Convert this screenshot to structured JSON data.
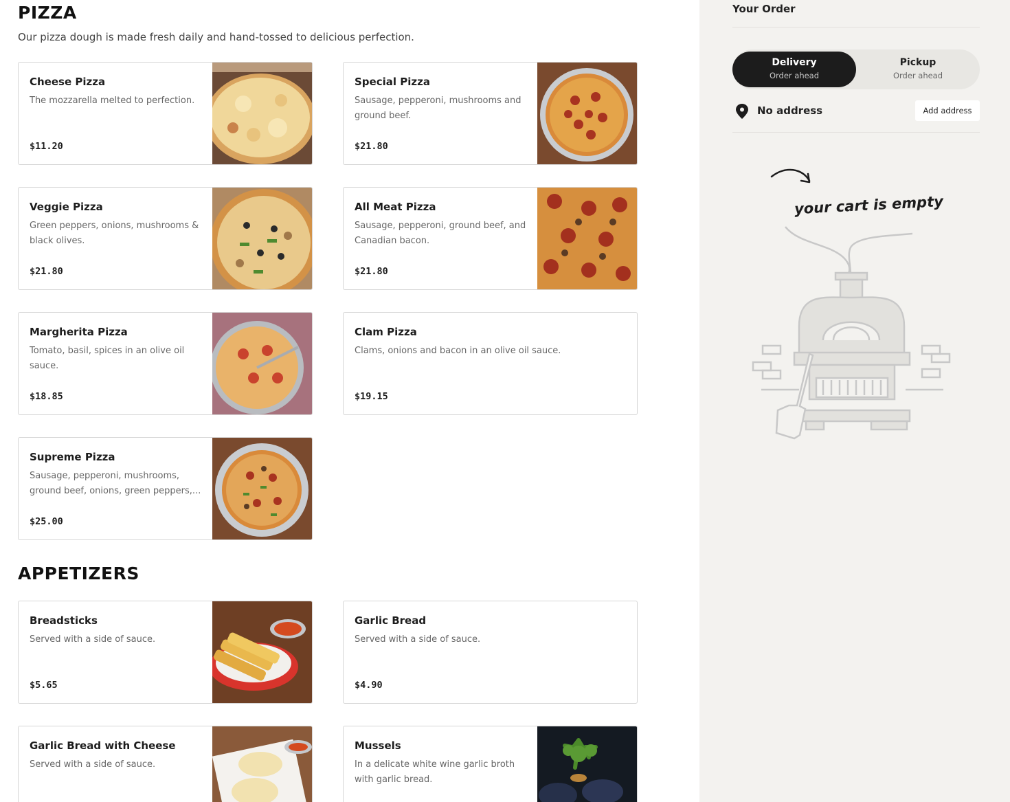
{
  "sections": {
    "pizza": {
      "title": "PIZZA",
      "description": "Our pizza dough is made fresh daily and hand-tossed to delicious perfection.",
      "items": [
        {
          "name": "Cheese Pizza",
          "description": "The mozzarella melted to perfection.",
          "price": "$11.20"
        },
        {
          "name": "Special Pizza",
          "description": "Sausage, pepperoni, mushrooms and ground beef.",
          "price": "$21.80"
        },
        {
          "name": "Veggie Pizza",
          "description": "Green peppers, onions, mushrooms & black olives.",
          "price": "$21.80"
        },
        {
          "name": "All Meat Pizza",
          "description": "Sausage, pepperoni, ground beef, and Canadian bacon.",
          "price": "$21.80"
        },
        {
          "name": "Margherita Pizza",
          "description": "Tomato, basil, spices in an olive oil sauce.",
          "price": "$18.85"
        },
        {
          "name": "Clam Pizza",
          "description": "Clams, onions and bacon in an olive oil sauce.",
          "price": "$19.15"
        },
        {
          "name": "Supreme Pizza",
          "description": "Sausage, pepperoni, mushrooms, ground beef, onions, green peppers,...",
          "price": "$25.00"
        }
      ]
    },
    "appetizers": {
      "title": "APPETIZERS",
      "items": [
        {
          "name": "Breadsticks",
          "description": "Served with a side of sauce.",
          "price": "$5.65"
        },
        {
          "name": "Garlic Bread",
          "description": "Served with a side of sauce.",
          "price": "$4.90"
        },
        {
          "name": "Garlic Bread with Cheese",
          "description": "Served with a side of sauce.",
          "price": ""
        },
        {
          "name": "Mussels",
          "description": "In a delicate white wine garlic broth with garlic bread.",
          "price": ""
        }
      ]
    }
  },
  "order": {
    "title": "Your Order",
    "delivery": {
      "label": "Delivery",
      "sub": "Order ahead"
    },
    "pickup": {
      "label": "Pickup",
      "sub": "Order ahead"
    },
    "address": "No address",
    "add_address": "Add address",
    "empty_cart": "your cart is empty"
  },
  "icons": {
    "location": "map-pin-icon",
    "arrow": "curved-arrow-icon",
    "illustration": "pizza-oven-icon"
  },
  "colors": {
    "sidebar_bg": "#f3f2ef",
    "toggle_active": "#1c1c1c",
    "card_border": "#d6d6d6"
  }
}
